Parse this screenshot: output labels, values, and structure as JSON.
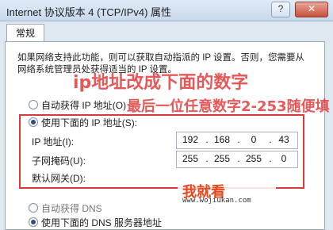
{
  "window": {
    "title": "Internet 协议版本 4 (TCP/IPv4) 属性"
  },
  "tabs": [
    {
      "label": "常规"
    }
  ],
  "general": {
    "description": "如果网络支持此功能，则可以获取自动指派的 IP 设置。否则，您需要从网络系统管理员处获得适当的 IP 设置。",
    "auto_ip_label": "自动获得 IP 地址(O)",
    "manual_ip_label": "使用下面的 IP 地址(S):",
    "ip_label": "IP 地址(I):",
    "ip_value": [
      "192",
      "168",
      "0",
      "43"
    ],
    "mask_label": "子网掩码(U):",
    "mask_value": [
      "255",
      "255",
      "255",
      "0"
    ],
    "gateway_label": "默认网关(D):",
    "auto_dns_label": "自动获得 DNS",
    "manual_dns_label": "使用下面的 DNS 服务器地址"
  },
  "annotations": {
    "line1": "ip地址改成下面的数字",
    "line2": "最后一位任意数字2-253随便填"
  },
  "watermark": {
    "main": "我就看",
    "sub": "www.wojiukan.com"
  },
  "colors": {
    "annotation": "#e13c3c",
    "red_box": "#d63a3a",
    "watermark": "#e7451b"
  }
}
